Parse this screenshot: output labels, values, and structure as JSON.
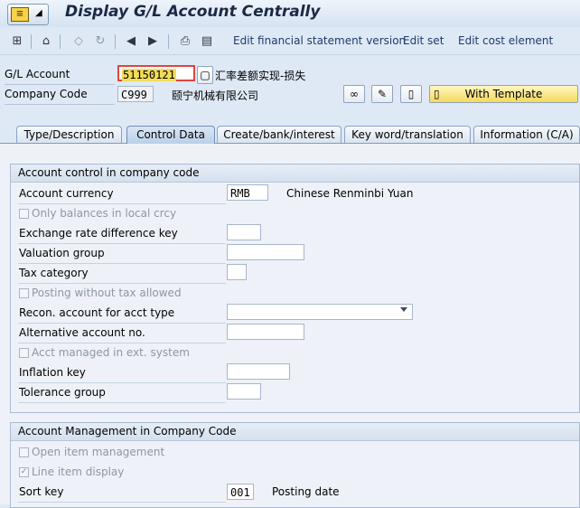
{
  "window": {
    "title": "Display G/L Account Centrally"
  },
  "toolbar": {
    "links": [
      "Edit financial statement version",
      "Edit set",
      "Edit cost element"
    ]
  },
  "header": {
    "gl_account_label": "G/L Account",
    "gl_account_value": "51150121",
    "gl_account_desc": "汇率差额实现-损失",
    "company_code_label": "Company Code",
    "company_code_value": "C999",
    "company_code_desc": "颐宁机械有限公司",
    "with_template_label": "With Template"
  },
  "tabs": [
    {
      "label": "Type/Description"
    },
    {
      "label": "Control Data"
    },
    {
      "label": "Create/bank/interest"
    },
    {
      "label": "Key word/translation"
    },
    {
      "label": "Information (C/A)"
    }
  ],
  "account_control": {
    "title": "Account control in company code",
    "account_currency_label": "Account currency",
    "account_currency_value": "RMB",
    "account_currency_desc": "Chinese Renminbi Yuan",
    "only_balances_label": "Only balances in local crcy",
    "exchange_rate_key_label": "Exchange rate difference key",
    "valuation_group_label": "Valuation group",
    "tax_category_label": "Tax category",
    "posting_without_tax_label": "Posting without tax allowed",
    "recon_account_label": "Recon. account for acct type",
    "alternative_account_label": "Alternative account no.",
    "acct_managed_ext_label": "Acct managed in ext. system",
    "inflation_key_label": "Inflation key",
    "tolerance_group_label": "Tolerance group"
  },
  "account_management": {
    "title": "Account Management in Company Code",
    "open_item_label": "Open item management",
    "line_item_label": "Line item display",
    "line_item_checked": "✓",
    "sort_key_label": "Sort key",
    "sort_key_value": "001",
    "sort_key_desc": "Posting date"
  }
}
